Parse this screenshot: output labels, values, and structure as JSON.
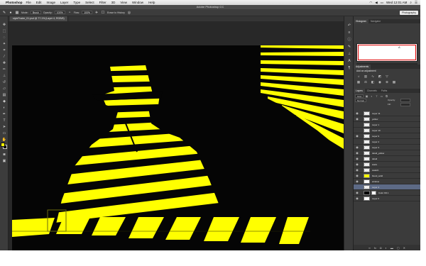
{
  "menubar": {
    "app_name": "Photoshop",
    "items": [
      "File",
      "Edit",
      "Image",
      "Layer",
      "Type",
      "Select",
      "Filter",
      "3D",
      "View",
      "Window",
      "Help"
    ],
    "clock": "Wed 12:01 AM"
  },
  "window": {
    "title": "Adobe Photoshop CC"
  },
  "options_bar": {
    "mode_label": "Mode:",
    "mode_value": "Brush",
    "opacity_label": "Opacity:",
    "opacity_value": "100%",
    "flow_label": "Flow:",
    "flow_value": "100%",
    "erase_history_label": "Erase to History",
    "workspace": "Photography"
  },
  "document": {
    "tab_title": "stylePoster_01.psd @ 77.1% (Layer 4, RGB/8)"
  },
  "canvas": {
    "background": "#050505",
    "accent": "#ffff00"
  },
  "panels": {
    "top_tabs": [
      "Histogram",
      "Navigator"
    ],
    "navigator_letter": "A",
    "adjustments_tab": "Adjustments",
    "adjustments_title": "Add an adjustment",
    "layers_tabs": [
      "Layers",
      "Channels",
      "Paths"
    ],
    "filter_kind": "Kind",
    "blend_mode": "Normal",
    "opacity_label": "Opacity:",
    "fill_label": "Fill:"
  },
  "layers": [
    {
      "name": "Layer 11",
      "thumb": "checker",
      "visible": true,
      "selected": false
    },
    {
      "name": "yellow",
      "thumb": "checker",
      "visible": true,
      "selected": false
    },
    {
      "name": "Layer 1",
      "thumb": "checker",
      "visible": false,
      "selected": false
    },
    {
      "name": "Layer 10",
      "thumb": "checker",
      "visible": false,
      "selected": false
    },
    {
      "name": "Layer 9",
      "thumb": "checker",
      "visible": true,
      "selected": false
    },
    {
      "name": "Layer 2",
      "thumb": "checker",
      "visible": false,
      "selected": false
    },
    {
      "name": "Layer 3",
      "thumb": "checker",
      "visible": true,
      "selected": false
    },
    {
      "name": "detail_yellow",
      "thumb": "checker",
      "visible": true,
      "selected": false
    },
    {
      "name": "detail",
      "thumb": "checker",
      "visible": true,
      "selected": false
    },
    {
      "name": "stairs",
      "thumb": "checker",
      "visible": true,
      "selected": false
    },
    {
      "name": "swatch",
      "thumb": "checker",
      "visible": true,
      "selected": false
    },
    {
      "name": "blend_solid",
      "thumb": "yellow",
      "visible": true,
      "selected": false
    },
    {
      "name": "window",
      "thumb": "white",
      "visible": true,
      "selected": false
    },
    {
      "name": "Layer 4",
      "thumb": "checker",
      "visible": false,
      "selected": true
    },
    {
      "name": "Color Fill 1",
      "thumb": "black",
      "visible": true,
      "selected": false,
      "mask": true
    },
    {
      "name": "Layer 0",
      "thumb": "white",
      "visible": true,
      "selected": false
    }
  ]
}
